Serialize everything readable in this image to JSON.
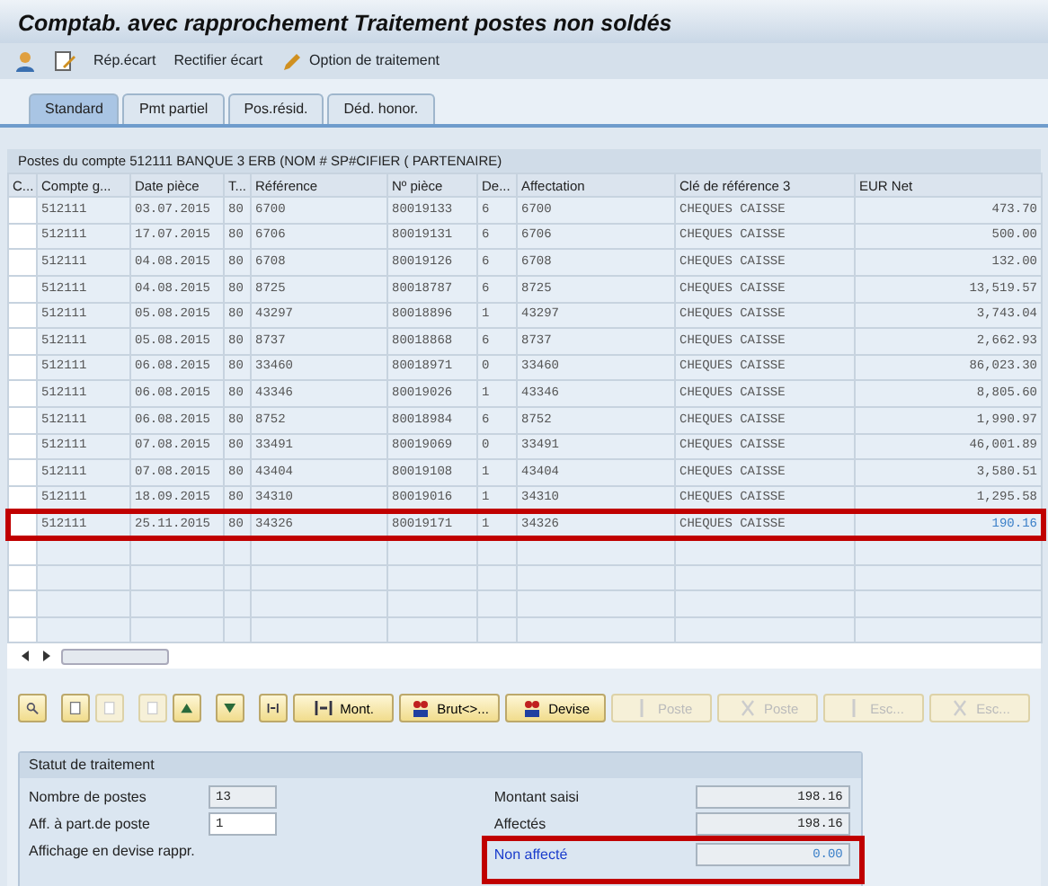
{
  "window": {
    "title": "Comptab. avec rapprochement Traitement postes non soldés"
  },
  "toolbar": [
    {
      "kind": "icon"
    },
    {
      "kind": "icon"
    },
    {
      "kind": "text",
      "label": "Rép.écart"
    },
    {
      "kind": "text",
      "label": "Rectifier écart"
    },
    {
      "kind": "text",
      "label": "Option de traitement"
    }
  ],
  "tabs": [
    {
      "label": "Standard",
      "selected": true
    },
    {
      "label": "Pmt partiel",
      "selected": false
    },
    {
      "label": "Pos.résid.",
      "selected": false
    },
    {
      "label": "Déd. honor.",
      "selected": false
    }
  ],
  "table": {
    "title": "Postes du compte 512111 BANQUE 3 ERB (NOM # SP#CIFIER ( PARTENAIRE)",
    "columns": [
      "C...",
      "Compte g...",
      "Date pièce",
      "T...",
      "Référence",
      "Nº pièce",
      "De...",
      "Affectation",
      "Clé de référence 3",
      "EUR Net"
    ],
    "rows": [
      {
        "cells": [
          "",
          "512111",
          "03.07.2015",
          "80",
          "6700",
          "80019133",
          "6",
          "6700",
          "CHEQUES CAISSE",
          "473.70"
        ],
        "selected": false
      },
      {
        "cells": [
          "",
          "512111",
          "17.07.2015",
          "80",
          "6706",
          "80019131",
          "6",
          "6706",
          "CHEQUES CAISSE",
          "500.00"
        ],
        "selected": false
      },
      {
        "cells": [
          "",
          "512111",
          "04.08.2015",
          "80",
          "6708",
          "80019126",
          "6",
          "6708",
          "CHEQUES CAISSE",
          "132.00"
        ],
        "selected": false
      },
      {
        "cells": [
          "",
          "512111",
          "04.08.2015",
          "80",
          "8725",
          "80018787",
          "6",
          "8725",
          "CHEQUES CAISSE",
          "13,519.57"
        ],
        "selected": false
      },
      {
        "cells": [
          "",
          "512111",
          "05.08.2015",
          "80",
          "43297",
          "80018896",
          "1",
          "43297",
          "CHEQUES CAISSE",
          "3,743.04"
        ],
        "selected": false
      },
      {
        "cells": [
          "",
          "512111",
          "05.08.2015",
          "80",
          "8737",
          "80018868",
          "6",
          "8737",
          "CHEQUES CAISSE",
          "2,662.93"
        ],
        "selected": false
      },
      {
        "cells": [
          "",
          "512111",
          "06.08.2015",
          "80",
          "33460",
          "80018971",
          "0",
          "33460",
          "CHEQUES CAISSE",
          "86,023.30"
        ],
        "selected": false
      },
      {
        "cells": [
          "",
          "512111",
          "06.08.2015",
          "80",
          "43346",
          "80019026",
          "1",
          "43346",
          "CHEQUES CAISSE",
          "8,805.60"
        ],
        "selected": false
      },
      {
        "cells": [
          "",
          "512111",
          "06.08.2015",
          "80",
          "8752",
          "80018984",
          "6",
          "8752",
          "CHEQUES CAISSE",
          "1,990.97"
        ],
        "selected": false
      },
      {
        "cells": [
          "",
          "512111",
          "07.08.2015",
          "80",
          "33491",
          "80019069",
          "0",
          "33491",
          "CHEQUES CAISSE",
          "46,001.89"
        ],
        "selected": false
      },
      {
        "cells": [
          "",
          "512111",
          "07.08.2015",
          "80",
          "43404",
          "80019108",
          "1",
          "43404",
          "CHEQUES CAISSE",
          "3,580.51"
        ],
        "selected": false
      },
      {
        "cells": [
          "",
          "512111",
          "18.09.2015",
          "80",
          "34310",
          "80019016",
          "1",
          "34310",
          "CHEQUES CAISSE",
          "1,295.58"
        ],
        "selected": false
      },
      {
        "cells": [
          "",
          "512111",
          "25.11.2015",
          "80",
          "34326",
          "80019171",
          "1",
          "34326",
          "CHEQUES CAISSE",
          "190.16"
        ],
        "selected": true
      }
    ]
  },
  "buttons": [
    {
      "kind": "icon",
      "disabled": false
    },
    {
      "kind": "icon",
      "disabled": false
    },
    {
      "kind": "icon",
      "disabled": true
    },
    {
      "kind": "icon",
      "disabled": true
    },
    {
      "kind": "icon",
      "disabled": false
    },
    {
      "kind": "icon",
      "disabled": false
    },
    {
      "kind": "icon",
      "disabled": false
    },
    {
      "kind": "text",
      "label": "Mont.",
      "disabled": false
    },
    {
      "kind": "text",
      "label": "Brut<>...",
      "disabled": false
    },
    {
      "kind": "text",
      "label": "Devise",
      "disabled": false
    },
    {
      "kind": "text",
      "label": "Poste",
      "disabled": true
    },
    {
      "kind": "text",
      "label": "Poste",
      "disabled": true
    },
    {
      "kind": "text",
      "label": "Esc...",
      "disabled": true
    },
    {
      "kind": "text",
      "label": "Esc...",
      "disabled": true
    }
  ],
  "status": {
    "title": "Statut de traitement",
    "left": [
      {
        "label": "Nombre de postes",
        "value": "13",
        "editable": false
      },
      {
        "label": "Aff. à part.de poste",
        "value": "1",
        "editable": true
      },
      {
        "label": "Affichage en devise rappr."
      }
    ],
    "right": [
      {
        "label": "Montant saisi",
        "value": "198.16",
        "link": false
      },
      {
        "label": "Affectés",
        "value": "198.16",
        "link": false
      },
      {
        "label": "Non affecté",
        "value": "0.00",
        "link": true
      }
    ]
  }
}
